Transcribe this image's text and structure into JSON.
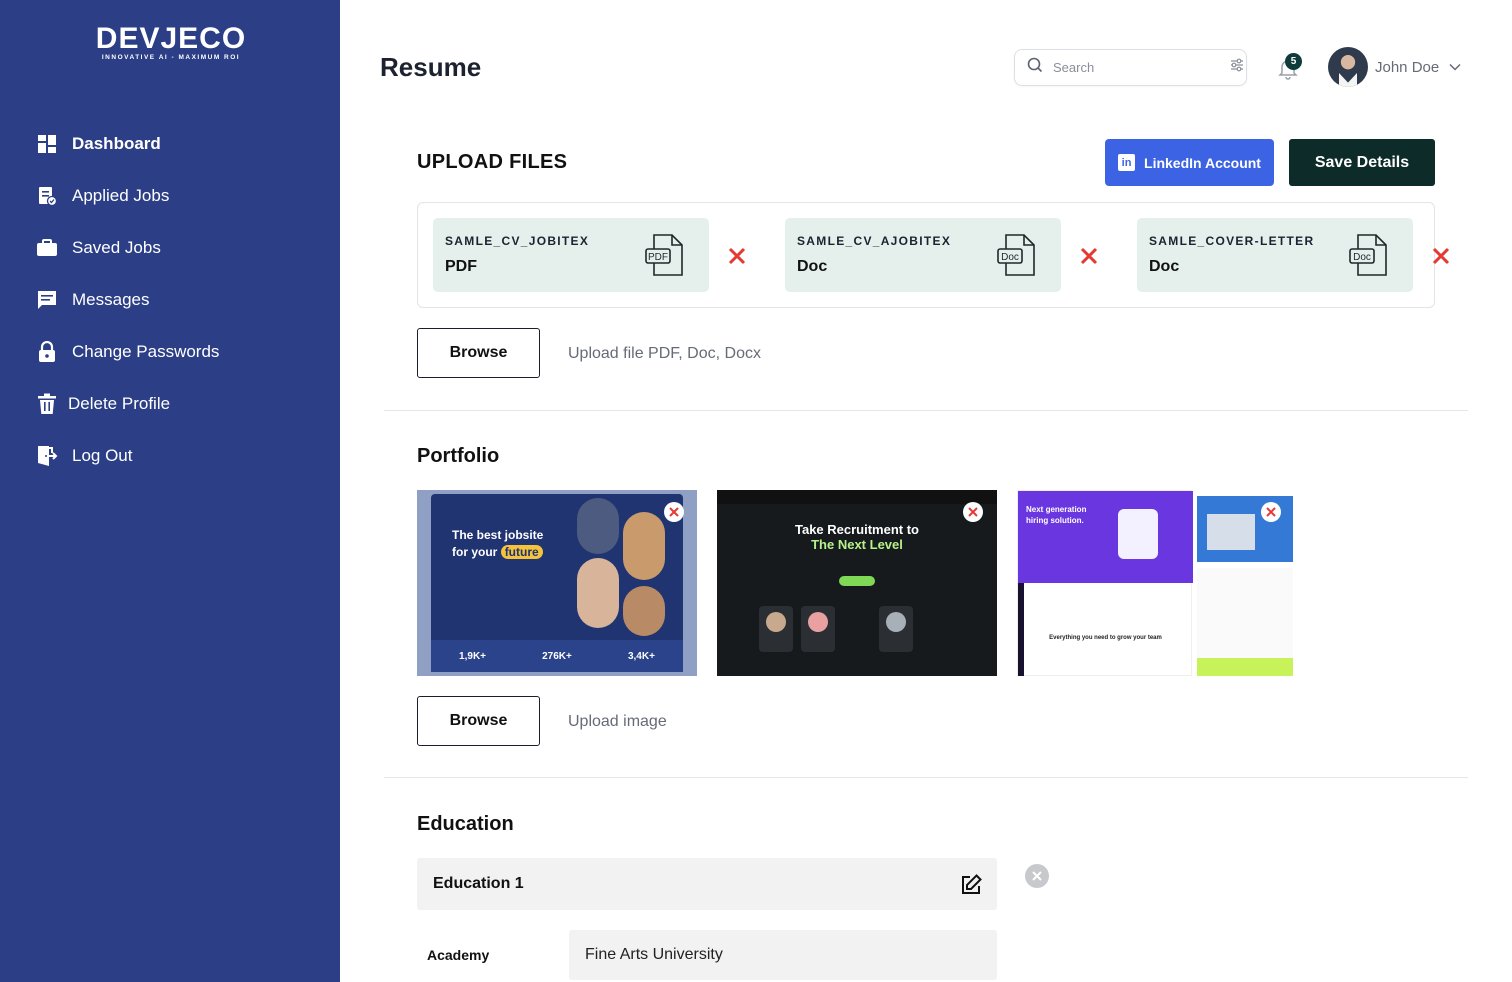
{
  "brand": {
    "name": "DEVJECO",
    "tagline": "INNOVATIVE AI - MAXIMUM ROI"
  },
  "sidebar": {
    "items": [
      {
        "label": "Dashboard",
        "icon": "dashboard-icon",
        "active": true
      },
      {
        "label": "Applied Jobs",
        "icon": "applied-jobs-icon"
      },
      {
        "label": "Saved Jobs",
        "icon": "briefcase-icon"
      },
      {
        "label": "Messages",
        "icon": "message-icon"
      },
      {
        "label": "Change Passwords",
        "icon": "lock-icon"
      },
      {
        "label": "Delete Profile",
        "icon": "trash-icon"
      },
      {
        "label": "Log Out",
        "icon": "logout-icon"
      }
    ]
  },
  "header": {
    "title": "Resume",
    "search_placeholder": "Search",
    "notification_count": "5",
    "user_name": "John Doe"
  },
  "upload": {
    "title": "UPLOAD FILES",
    "linkedin_label": "LinkedIn Account",
    "save_label": "Save Details",
    "files": [
      {
        "name": "SAMLE_CV_JOBITEX",
        "type": "PDF",
        "icon_text": "PDF"
      },
      {
        "name": "SAMLE_CV_AJOBITEX",
        "type": "Doc",
        "icon_text": "Doc"
      },
      {
        "name": "SAMLE_COVER-LETTER",
        "type": "Doc",
        "icon_text": "Doc"
      }
    ],
    "browse_label": "Browse",
    "hint": "Upload file PDF, Doc, Docx"
  },
  "portfolio": {
    "title": "Portfolio",
    "items": [
      {
        "headline_1": "The best jobsite",
        "headline_2": "for your",
        "headline_highlight": "future",
        "stats": [
          {
            "value": "1,9K+"
          },
          {
            "value": "276K+"
          },
          {
            "value": "3,4K+"
          }
        ]
      },
      {
        "headline_1": "Take Recruitment to",
        "headline_2": "The Next Level"
      },
      {
        "headline_1": "Next generation",
        "headline_2": "hiring solution.",
        "sub": "Everything you need to grow your team"
      }
    ],
    "browse_label": "Browse",
    "hint": "Upload image"
  },
  "education": {
    "title": "Education",
    "entry_title": "Education 1",
    "academy_label": "Academy",
    "academy_value": "Fine Arts University"
  },
  "colors": {
    "sidebar": "#2b3e86",
    "linkedin": "#3c63e3",
    "save": "#0d2c29",
    "file_card": "#e5efec",
    "remove": "#e53935"
  }
}
